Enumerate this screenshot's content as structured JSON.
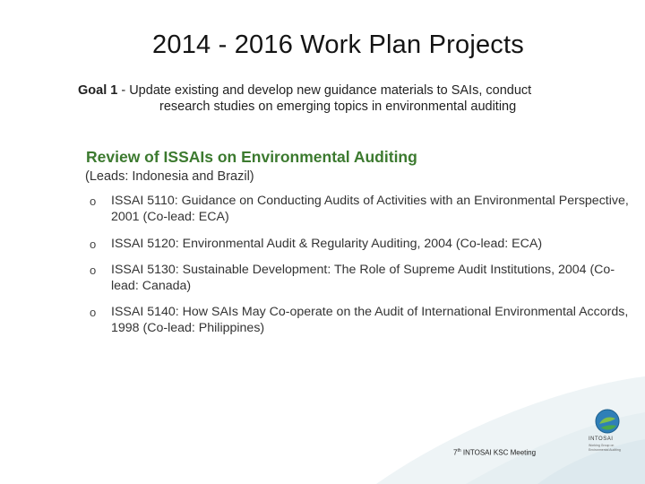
{
  "slide": {
    "title": "2014 - 2016 Work Plan Projects",
    "goal": {
      "label": "Goal 1",
      "text_line1": " - Update existing and develop new guidance materials to SAIs, conduct",
      "text_line2": "research studies on emerging topics in environmental auditing"
    },
    "section": {
      "heading": "Review of ISSAIs on Environmental Auditing",
      "leads": "(Leads: Indonesia and Brazil)"
    },
    "items": [
      {
        "bullet": "o",
        "text": "ISSAI 5110: Guidance on Conducting Audits of Activities with an Environmental Perspective, 2001 (Co-lead: ECA)"
      },
      {
        "bullet": "o",
        "text": "ISSAI 5120: Environmental Audit & Regularity Auditing, 2004 (Co-lead: ECA)"
      },
      {
        "bullet": "o",
        "text": "ISSAI 5130: Sustainable Development: The Role of Supreme Audit Institutions, 2004 (Co-lead: Canada)"
      },
      {
        "bullet": "o",
        "text": "ISSAI 5140: How SAIs May Co-operate on the Audit of International Environmental Accords, 1998 (Co-lead: Philippines)"
      }
    ],
    "footer": {
      "ordinal": "7",
      "ordinal_suffix": "th",
      "text": " INTOSAI KSC Meeting"
    },
    "logo": {
      "name": "INTOSAI",
      "subtitle": "Working Group on Environmental Auditing"
    },
    "colors": {
      "heading_green": "#3c7a2f",
      "swoosh": "#e9f1f4"
    }
  }
}
